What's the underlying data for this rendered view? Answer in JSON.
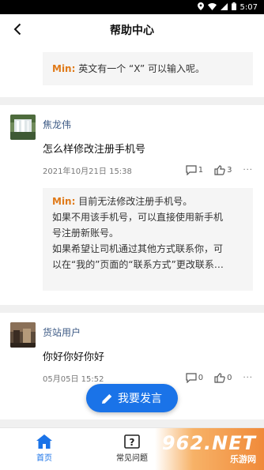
{
  "status_bar": {
    "time": "5:07"
  },
  "header": {
    "title": "帮助中心"
  },
  "top_reply": {
    "author": "Min:",
    "text": "英文有一个 “X” 可以输入呢。"
  },
  "posts": [
    {
      "username": "焦龙伟",
      "content": "怎么样修改注册手机号",
      "date": "2021年10月21日 15:38",
      "comments": "1",
      "likes": "3",
      "reply": {
        "author": "Min:",
        "line1": "目前无法修改注册手机号。",
        "line2": "如果不用该手机号，可以直接使用新手机",
        "line3": "号注册新账号。",
        "line4": "如果希望让司机通过其他方式联系你，可",
        "line5": "以在“我的”页面的“联系方式”更改联系…"
      }
    },
    {
      "username": "货站用户",
      "content": "你好你好你好",
      "date": "05月05日 15:52",
      "comments": "0",
      "likes": "0"
    }
  ],
  "fab": {
    "label": "我要发言"
  },
  "tabbar": {
    "home": "首页",
    "faq": "常见问题"
  },
  "watermark": {
    "big": "962.NET",
    "small": "乐游网"
  },
  "colors": {
    "accent": "#1a73e8",
    "author": "#e07a19",
    "username": "#3d5a85"
  }
}
